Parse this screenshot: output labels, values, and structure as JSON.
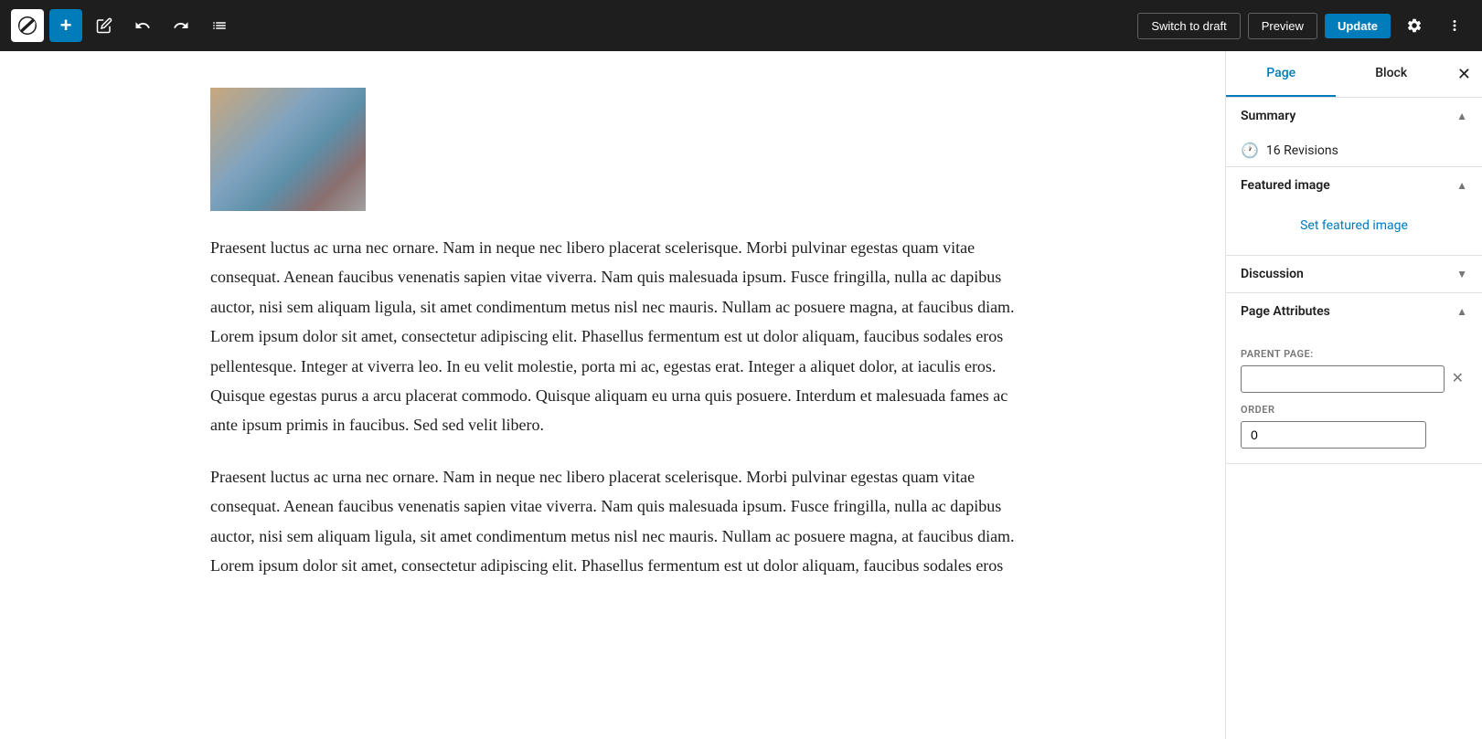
{
  "toolbar": {
    "wp_logo_alt": "WordPress",
    "add_label": "+",
    "edit_label": "✏",
    "undo_label": "↩",
    "redo_label": "↪",
    "list_view_label": "≡",
    "switch_to_draft_label": "Switch to draft",
    "preview_label": "Preview",
    "update_label": "Update",
    "settings_label": "⚙",
    "more_label": "⋮"
  },
  "sidebar": {
    "tabs": [
      {
        "label": "Page",
        "active": true
      },
      {
        "label": "Block",
        "active": false
      }
    ],
    "close_label": "✕",
    "summary": {
      "label": "Summary",
      "revisions_icon": "🕐",
      "revisions_label": "16 Revisions"
    },
    "featured_image": {
      "label": "Featured image",
      "set_label": "Set featured image"
    },
    "discussion": {
      "label": "Discussion"
    },
    "page_attributes": {
      "label": "Page Attributes",
      "parent_page_label": "PARENT PAGE:",
      "parent_page_value": "",
      "order_label": "ORDER",
      "order_value": "0"
    }
  },
  "editor": {
    "paragraph1": "Praesent luctus ac urna nec ornare. Nam in neque nec libero placerat scelerisque. Morbi pulvinar egestas quam vitae consequat. Aenean faucibus venenatis sapien vitae viverra. Nam quis malesuada ipsum. Fusce fringilla, nulla ac dapibus auctor, nisi sem aliquam ligula, sit amet condimentum metus nisl nec mauris. Nullam ac posuere magna, at faucibus diam. Lorem ipsum dolor sit amet, consectetur adipiscing elit. Phasellus fermentum est ut dolor aliquam, faucibus sodales eros pellentesque. Integer at viverra leo. In eu velit molestie, porta mi ac, egestas erat. Integer a aliquet dolor, at iaculis eros. Quisque egestas purus a arcu placerat commodo. Quisque aliquam eu urna quis posuere. Interdum et malesuada fames ac ante ipsum primis in faucibus. Sed sed velit libero.",
    "paragraph2": "Praesent luctus ac urna nec ornare. Nam in neque nec libero placerat scelerisque. Morbi pulvinar egestas quam vitae consequat. Aenean faucibus venenatis sapien vitae viverra. Nam quis malesuada ipsum. Fusce fringilla, nulla ac dapibus auctor, nisi sem aliquam ligula, sit amet condimentum metus nisl nec mauris. Nullam ac posuere magna, at faucibus diam. Lorem ipsum dolor sit amet, consectetur adipiscing elit. Phasellus fermentum est ut dolor aliquam, faucibus sodales eros"
  }
}
